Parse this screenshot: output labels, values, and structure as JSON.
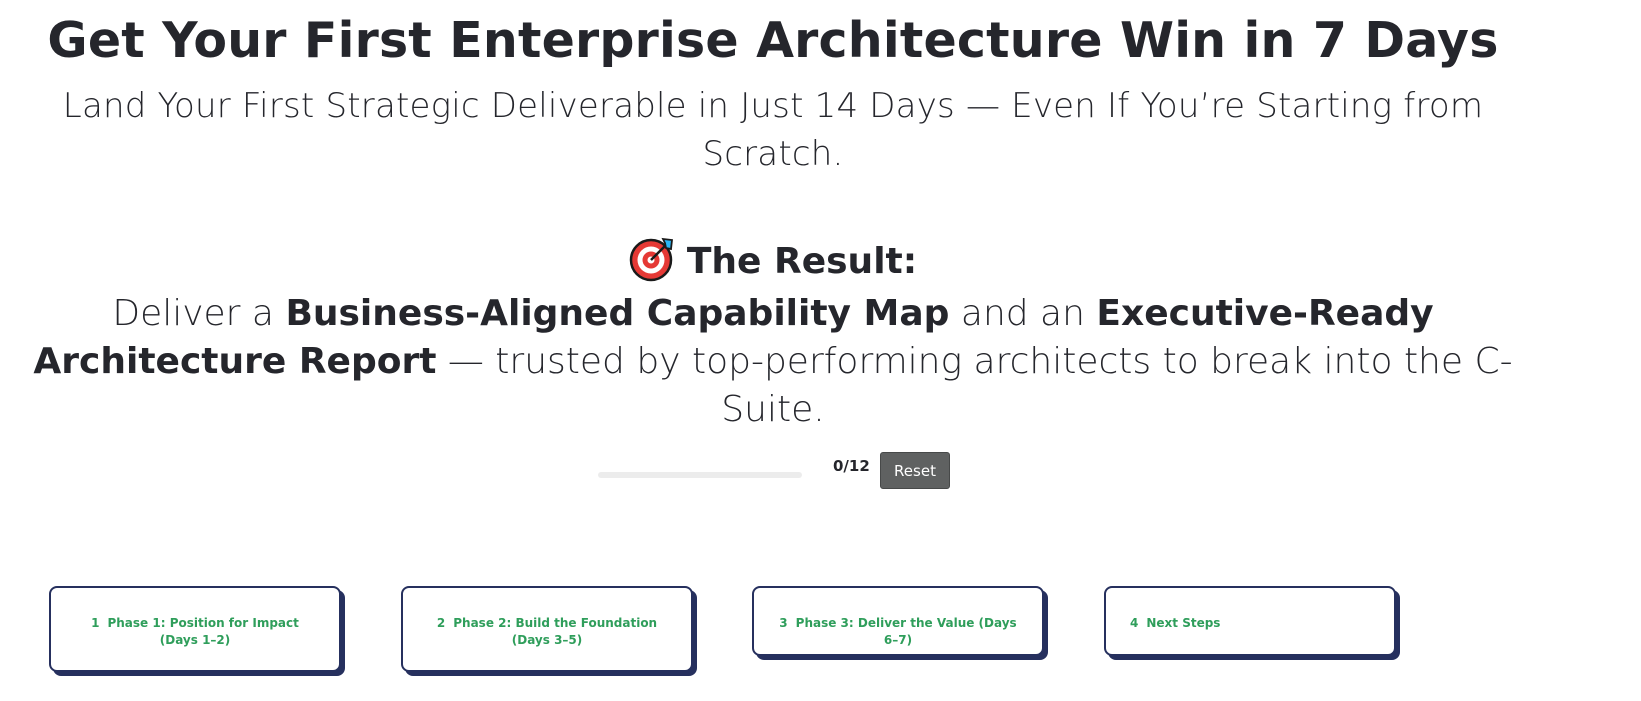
{
  "hero": {
    "title": "Get Your First Enterprise Architecture Win in 7 Days",
    "subtitle": "Land Your First Strategic Deliverable in Just 14 Days — Even If You’re Starting from Scratch."
  },
  "result": {
    "icon": "target-dart-icon",
    "heading": "The Result:",
    "text_1": "Deliver a ",
    "bold_1": "Business-Aligned Capability Map",
    "text_2": " and an ",
    "bold_2": "Executive-Ready Architecture Report",
    "text_3": " — trusted by top-performing architects to break into the C-Suite."
  },
  "progress": {
    "completed": 0,
    "total": 12,
    "label": "0/12",
    "reset_label": "Reset",
    "fill_color": "#2f9e5b"
  },
  "phases": [
    {
      "number": "1",
      "title": "Phase 1: Position for Impact (Days 1–2)"
    },
    {
      "number": "2",
      "title": "Phase 2: Build the Foundation (Days 3–5)"
    },
    {
      "number": "3",
      "title": "Phase 3: Deliver the Value (Days 6–7)"
    },
    {
      "number": "4",
      "title": "Next Steps"
    }
  ],
  "colors": {
    "text": "#25262c",
    "accent_green": "#2f9e5b",
    "card_border": "#26305e",
    "reset_button": "#5f6161"
  }
}
